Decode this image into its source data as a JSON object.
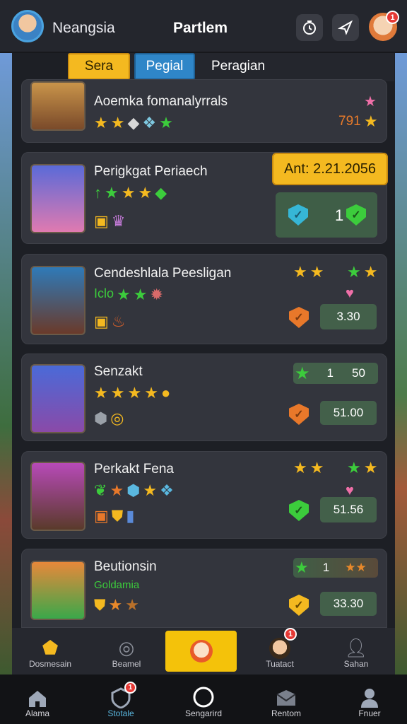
{
  "header": {
    "username": "Neangsia",
    "title": "Partlem",
    "notif_count": "1"
  },
  "tabs": [
    {
      "label": "Sera"
    },
    {
      "label": "Pegial"
    },
    {
      "label": "Peragian"
    }
  ],
  "cards": [
    {
      "name": "Aoemka fomanalyrrals",
      "score": "791"
    },
    {
      "name": "Perigkgat Periaech",
      "date": "Ant: 2.21.2056",
      "count": "1"
    },
    {
      "name": "Cendeshlala Peesligan",
      "left_tag": "Iclo",
      "value": "3.30"
    },
    {
      "name": "Senzakt",
      "pill_a": "1",
      "pill_b": "50",
      "value": "51.00"
    },
    {
      "name": "Perkakt Fena",
      "value": "51.56"
    },
    {
      "name": "Beutionsin",
      "sub": "Goldamia",
      "pill_a": "1",
      "value": "33.30"
    }
  ],
  "bottom_tabs": [
    {
      "label": "Dosmesain"
    },
    {
      "label": "Beamel"
    },
    {
      "label": ""
    },
    {
      "label": "Tuatact",
      "badge": "1"
    },
    {
      "label": "Sahan"
    }
  ],
  "nav": [
    {
      "label": "Alama"
    },
    {
      "label": "Stotale",
      "badge": "1"
    },
    {
      "label": "Sengarird"
    },
    {
      "label": "Rentom"
    },
    {
      "label": "Fnuer"
    }
  ],
  "colors": {
    "accent_yellow": "#f4b920",
    "accent_blue": "#2f86c8",
    "green": "#3ccc3c"
  }
}
